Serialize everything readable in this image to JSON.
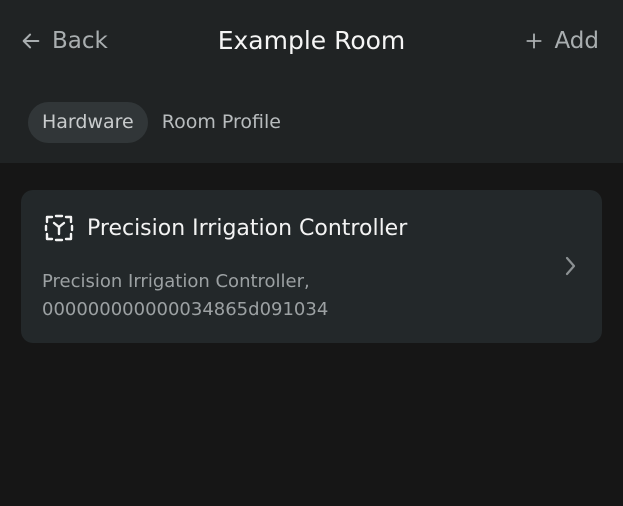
{
  "nav": {
    "back_label": "Back",
    "title": "Example Room",
    "add_label": "Add"
  },
  "tabs": [
    {
      "label": "Hardware",
      "active": true
    },
    {
      "label": "Room Profile",
      "active": false
    }
  ],
  "devices": [
    {
      "name": "Precision Irrigation Controller",
      "subtitle_line1": "Precision Irrigation Controller,",
      "subtitle_line2": "000000000000034865d091034",
      "icon": "device-scan-icon"
    }
  ],
  "colors": {
    "background": "#161616",
    "header": "#202324",
    "card": "#23282a",
    "active_tab": "#313638",
    "muted_text": "#a9aeb0"
  }
}
